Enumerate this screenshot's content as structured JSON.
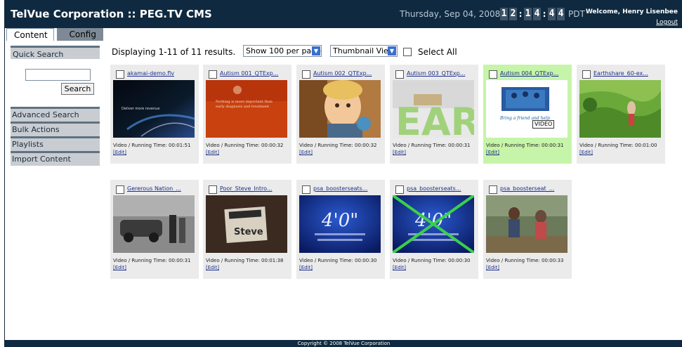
{
  "header": {
    "title": "TelVue Corporation :: PEG.TV CMS",
    "date": "Thursday, Sep 04, 2008",
    "clock_digits": [
      "1",
      "2",
      "1",
      "4",
      "4",
      "4"
    ],
    "timezone": "PDT",
    "welcome": "Welcome, Henry Lisenbee",
    "logout": "Logout"
  },
  "tabs": [
    {
      "label": "Content",
      "active": true
    },
    {
      "label": "Config",
      "active": false
    }
  ],
  "sidebar": {
    "quick_search": "Quick Search",
    "search_value": "",
    "search_button": "Search",
    "items": [
      "Advanced Search",
      "Bulk Actions",
      "Playlists",
      "Import Content"
    ]
  },
  "toolbar": {
    "results": "Displaying 1-11 of 11 results.",
    "per_page": "Show 100 per page",
    "view_mode": "Thumbnail View",
    "select_all": "Select All"
  },
  "items": [
    {
      "title": "akamai-demo.flv",
      "meta": "Video / Running Time: 00:01:51",
      "edit": "[Edit]",
      "thumb_text": "Deliver more revenue",
      "active": false
    },
    {
      "title": "Autism 001_QTExp...",
      "meta": "Video / Running Time: 00:00:32",
      "edit": "[Edit]",
      "thumb_text": "Nothing is more important than early diagnosis and treatment",
      "active": false
    },
    {
      "title": "Autism 002_QTExp...",
      "meta": "Video / Running Time: 00:00:32",
      "edit": "[Edit]",
      "thumb_text": "",
      "active": false
    },
    {
      "title": "Autism 003_QTExp...",
      "meta": "Video / Running Time: 00:00:31",
      "edit": "[Edit]",
      "thumb_text": "EAR",
      "active": false
    },
    {
      "title": "Autism 004_QTExp...",
      "meta": "Video / Running Time: 00:00:31",
      "edit": "[Edit]",
      "thumb_text": "Bring a friend and help",
      "active": true,
      "tooltip": "VIDEO"
    },
    {
      "title": "Earthshare_60-ex...",
      "meta": "Video / Running Time: 00:01:00",
      "edit": "[Edit]",
      "thumb_text": "",
      "active": false
    },
    {
      "title": "Gererous Nation_...",
      "meta": "Video / Running Time: 00:00:31",
      "edit": "[Edit]",
      "thumb_text": "",
      "active": false
    },
    {
      "title": "Poor_Steve_Intro...",
      "meta": "Video / Running Time: 00:01:38",
      "edit": "[Edit]",
      "thumb_text": "Steve",
      "active": false
    },
    {
      "title": "psa_boosterseats...",
      "meta": "Video / Running Time: 00:00:30",
      "edit": "[Edit]",
      "thumb_text": "4'0\"",
      "active": false
    },
    {
      "title": "psa_boosterseats...",
      "meta": "Video / Running Time: 00:00:30",
      "edit": "[Edit]",
      "thumb_text": "4'0\"",
      "active": false
    },
    {
      "title": "psa_boosterseat_...",
      "meta": "Video / Running Time: 00:00:33",
      "edit": "[Edit]",
      "thumb_text": "",
      "active": false
    }
  ],
  "footer": "Copyright © 2008 TelVue Corporation"
}
